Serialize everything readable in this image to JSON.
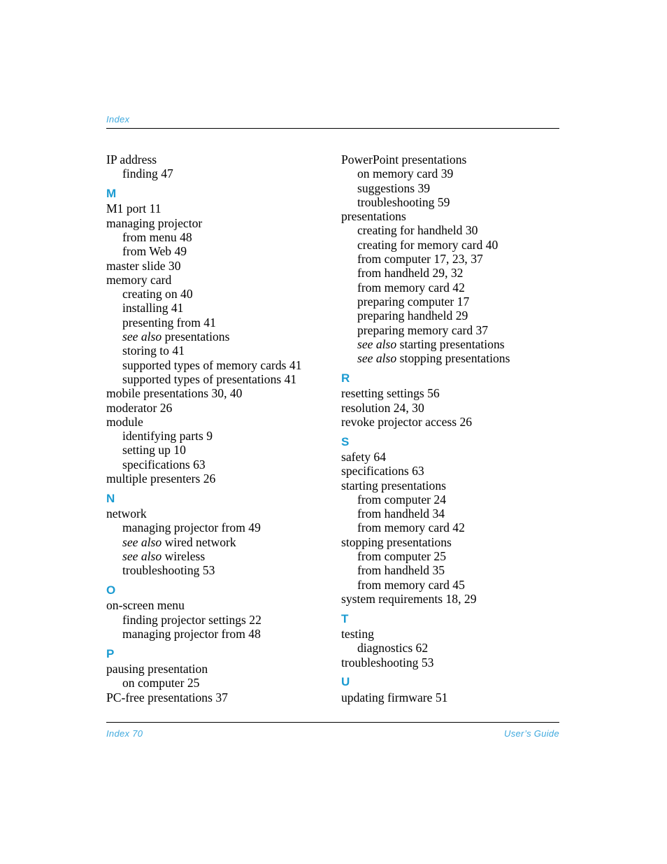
{
  "header": {
    "label": "Index"
  },
  "footer": {
    "left": "Index 70",
    "right": "User’s Guide"
  },
  "colors": {
    "accent": "#1B9BD1",
    "header_accent": "#3FA9DE",
    "rule": "#000000",
    "text": "#000000"
  },
  "columns": {
    "left": [
      {
        "kind": "entry",
        "level": "main",
        "text": "IP address"
      },
      {
        "kind": "entry",
        "level": "sub",
        "text": "finding 47"
      },
      {
        "kind": "letter",
        "text": "M"
      },
      {
        "kind": "entry",
        "level": "main",
        "text": "M1 port 11"
      },
      {
        "kind": "entry",
        "level": "main",
        "text": "managing projector"
      },
      {
        "kind": "entry",
        "level": "sub",
        "text": "from menu 48"
      },
      {
        "kind": "entry",
        "level": "sub",
        "text": "from Web 49"
      },
      {
        "kind": "entry",
        "level": "main",
        "text": "master slide 30"
      },
      {
        "kind": "entry",
        "level": "main",
        "text": "memory card"
      },
      {
        "kind": "entry",
        "level": "sub",
        "text": "creating on 40"
      },
      {
        "kind": "entry",
        "level": "sub",
        "text": "installing 41"
      },
      {
        "kind": "entry",
        "level": "sub",
        "text": "presenting from 41"
      },
      {
        "kind": "seealso",
        "level": "sub",
        "italic": "see also",
        "text": "presentations"
      },
      {
        "kind": "entry",
        "level": "sub",
        "text": "storing to 41"
      },
      {
        "kind": "entry",
        "level": "sub",
        "text": "supported types of memory cards 41"
      },
      {
        "kind": "entry",
        "level": "sub",
        "text": "supported types of presentations 41"
      },
      {
        "kind": "entry",
        "level": "main",
        "text": "mobile presentations 30, 40"
      },
      {
        "kind": "entry",
        "level": "main",
        "text": "moderator 26"
      },
      {
        "kind": "entry",
        "level": "main",
        "text": "module"
      },
      {
        "kind": "entry",
        "level": "sub",
        "text": "identifying parts 9"
      },
      {
        "kind": "entry",
        "level": "sub",
        "text": "setting up 10"
      },
      {
        "kind": "entry",
        "level": "sub",
        "text": "specifications 63"
      },
      {
        "kind": "entry",
        "level": "main",
        "text": "multiple presenters 26"
      },
      {
        "kind": "letter",
        "text": "N"
      },
      {
        "kind": "entry",
        "level": "main",
        "text": "network"
      },
      {
        "kind": "entry",
        "level": "sub",
        "text": "managing projector from 49"
      },
      {
        "kind": "seealso",
        "level": "sub",
        "italic": "see also",
        "text": "wired network"
      },
      {
        "kind": "seealso",
        "level": "sub",
        "italic": "see also",
        "text": "wireless"
      },
      {
        "kind": "entry",
        "level": "sub",
        "text": "troubleshooting 53"
      },
      {
        "kind": "letter",
        "text": "O"
      },
      {
        "kind": "entry",
        "level": "main",
        "text": "on-screen menu"
      },
      {
        "kind": "entry",
        "level": "sub",
        "text": "finding projector settings 22"
      },
      {
        "kind": "entry",
        "level": "sub",
        "text": "managing projector from 48"
      },
      {
        "kind": "letter",
        "text": "P"
      },
      {
        "kind": "entry",
        "level": "main",
        "text": "pausing presentation"
      },
      {
        "kind": "entry",
        "level": "sub",
        "text": "on computer 25"
      },
      {
        "kind": "entry",
        "level": "main",
        "text": "PC-free presentations 37"
      }
    ],
    "right": [
      {
        "kind": "entry",
        "level": "main",
        "text": "PowerPoint presentations"
      },
      {
        "kind": "entry",
        "level": "sub",
        "text": "on memory card 39"
      },
      {
        "kind": "entry",
        "level": "sub",
        "text": "suggestions 39"
      },
      {
        "kind": "entry",
        "level": "sub",
        "text": "troubleshooting 59"
      },
      {
        "kind": "entry",
        "level": "main",
        "text": "presentations"
      },
      {
        "kind": "entry",
        "level": "sub",
        "text": "creating for handheld 30"
      },
      {
        "kind": "entry",
        "level": "sub",
        "text": "creating for memory card 40"
      },
      {
        "kind": "entry",
        "level": "sub",
        "text": "from computer 17, 23, 37"
      },
      {
        "kind": "entry",
        "level": "sub",
        "text": "from handheld 29, 32"
      },
      {
        "kind": "entry",
        "level": "sub",
        "text": "from memory card 42"
      },
      {
        "kind": "entry",
        "level": "sub",
        "text": "preparing computer 17"
      },
      {
        "kind": "entry",
        "level": "sub",
        "text": "preparing handheld 29"
      },
      {
        "kind": "entry",
        "level": "sub",
        "text": "preparing memory card 37"
      },
      {
        "kind": "seealso",
        "level": "sub",
        "italic": "see also",
        "text": "starting presentations"
      },
      {
        "kind": "seealso",
        "level": "sub",
        "italic": "see also",
        "text": "stopping presentations"
      },
      {
        "kind": "letter",
        "text": "R"
      },
      {
        "kind": "entry",
        "level": "main",
        "text": "resetting settings 56"
      },
      {
        "kind": "entry",
        "level": "main",
        "text": "resolution 24, 30"
      },
      {
        "kind": "entry",
        "level": "main",
        "text": "revoke projector access 26"
      },
      {
        "kind": "letter",
        "text": "S"
      },
      {
        "kind": "entry",
        "level": "main",
        "text": "safety 64"
      },
      {
        "kind": "entry",
        "level": "main",
        "text": "specifications 63"
      },
      {
        "kind": "entry",
        "level": "main",
        "text": "starting presentations"
      },
      {
        "kind": "entry",
        "level": "sub",
        "text": "from computer 24"
      },
      {
        "kind": "entry",
        "level": "sub",
        "text": "from handheld 34"
      },
      {
        "kind": "entry",
        "level": "sub",
        "text": "from memory card 42"
      },
      {
        "kind": "entry",
        "level": "main",
        "text": "stopping presentations"
      },
      {
        "kind": "entry",
        "level": "sub",
        "text": "from computer 25"
      },
      {
        "kind": "entry",
        "level": "sub",
        "text": "from handheld 35"
      },
      {
        "kind": "entry",
        "level": "sub",
        "text": "from memory card 45"
      },
      {
        "kind": "entry",
        "level": "main",
        "text": "system requirements 18, 29"
      },
      {
        "kind": "letter",
        "text": "T"
      },
      {
        "kind": "entry",
        "level": "main",
        "text": "testing"
      },
      {
        "kind": "entry",
        "level": "sub",
        "text": "diagnostics 62"
      },
      {
        "kind": "entry",
        "level": "main",
        "text": "troubleshooting 53"
      },
      {
        "kind": "letter",
        "text": "U"
      },
      {
        "kind": "entry",
        "level": "main",
        "text": "updating firmware 51"
      }
    ]
  }
}
